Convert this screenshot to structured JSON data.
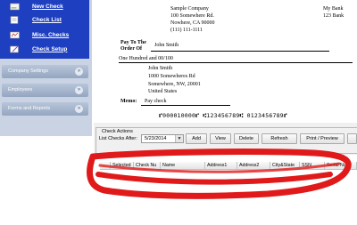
{
  "sidebar": {
    "nav_items": [
      {
        "label": "New Check",
        "icon": "new-check-icon"
      },
      {
        "label": "Check List",
        "icon": "check-list-icon"
      },
      {
        "label": "Misc. Checks",
        "icon": "misc-checks-icon"
      },
      {
        "label": "Check Setup",
        "icon": "check-setup-icon"
      }
    ],
    "sections": [
      {
        "label": "Company Settings",
        "icon": "chevron-down-icon"
      },
      {
        "label": "Employees",
        "icon": "chevron-down-icon"
      },
      {
        "label": "Forms and Reports",
        "icon": "chevron-down-icon"
      }
    ]
  },
  "check": {
    "company_name": "Sample Company",
    "company_address1": "100 Somewhere Rd.",
    "company_address2": "Nowhere, CA 90000",
    "company_phone": "(111) 111-1111",
    "bank_name": "My Bank",
    "bank_address": "123 Bank",
    "pay_to_label_1": "Pay To The",
    "pay_to_label_2": "Order Of",
    "payee": "John Smith",
    "amount_words": "One Hundred  and 00/100",
    "payee_name": "John Smith",
    "payee_address1": "1000 Somewheres Rd",
    "payee_address2": "Somewhere, NW, 20001",
    "payee_country": "United States",
    "memo_label": "Memo:",
    "memo": "Pay check",
    "micr_line": "⑈000010000⑈ ⑆123456789⑆ 0123456789⑈"
  },
  "actions": {
    "group_label": "Check Actions",
    "list_after_label": "List Checks After:",
    "date_value": "5/23/2014",
    "buttons": [
      "Add",
      "View",
      "Delete",
      "Refresh",
      "Print / Preview"
    ]
  },
  "grid": {
    "columns": [
      "Selected",
      "Check Nu",
      "Name",
      "Address1",
      "Address2",
      "City&State",
      "SSN",
      "Serial Num"
    ]
  },
  "colors": {
    "nav_blue": "#1e3fbf",
    "sidebar_bg": "#c9d3e4",
    "annotation_red": "#e01a1a"
  }
}
